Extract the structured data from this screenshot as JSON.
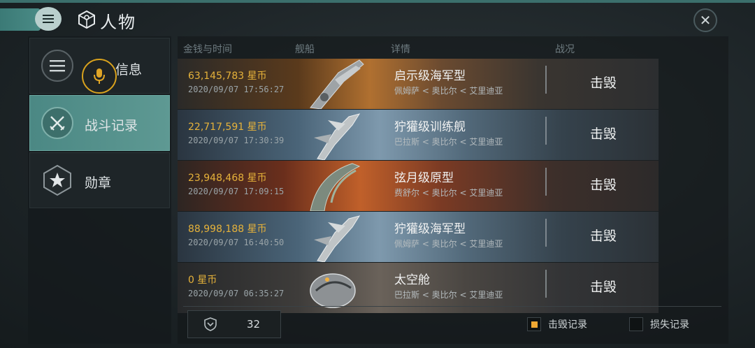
{
  "header": {
    "title": "人物"
  },
  "sidebar": {
    "items": [
      {
        "label": "信息",
        "icon": "list-icon",
        "active": false
      },
      {
        "label": "战斗记录",
        "icon": "crossed-swords-icon",
        "active": true
      },
      {
        "label": "勋章",
        "icon": "star-badge-icon",
        "active": false
      }
    ],
    "mic_icon": "microphone-icon"
  },
  "table": {
    "headers": {
      "money_time": "金钱与时间",
      "ship": "舰船",
      "detail": "详情",
      "result": "战况"
    },
    "rows": [
      {
        "money": "63,145,783  星币",
        "date": "2020/09/07  17:56:27",
        "ship_name": "启示级海军型",
        "location": "佩姆萨 < 奥比尔 < 艾里迪亚",
        "result": "击毁",
        "bg": "nebula-orange"
      },
      {
        "money": "22,717,591  星币",
        "date": "2020/09/07  17:30:39",
        "ship_name": "狞獾级训练舰",
        "location": "巴拉斯 < 奥比尔 < 艾里迪亚",
        "result": "击毁",
        "bg": "nebula-blue"
      },
      {
        "money": "23,948,468  星币",
        "date": "2020/09/07  17:09:15",
        "ship_name": "弦月级原型",
        "location": "费舒尔 < 奥比尔 < 艾里迪亚",
        "result": "击毁",
        "bg": "nebula-red"
      },
      {
        "money": "88,998,188  星币",
        "date": "2020/09/07  16:40:50",
        "ship_name": "狞獾级海军型",
        "location": "佩姆萨 < 奥比尔 < 艾里迪亚",
        "result": "击毁",
        "bg": "nebula-blue"
      },
      {
        "money": "0  星币",
        "date": "2020/09/07  06:35:27",
        "ship_name": "太空舱",
        "location": "巴拉斯 < 奥比尔 < 艾里迪亚",
        "result": "击毁",
        "bg": "nebula-grey"
      }
    ]
  },
  "footer": {
    "count": "32",
    "count_icon": "shield-icon",
    "legend_kill": "击毁记录",
    "legend_loss": "损失记录",
    "kill_checked": true,
    "loss_checked": false
  },
  "colors": {
    "accent_teal": "#4b8884",
    "gold": "#e6b23a",
    "highlight": "#d9a21d"
  }
}
